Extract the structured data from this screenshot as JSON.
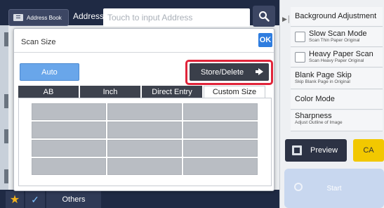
{
  "topbar": {
    "address_book_label": "Address Book",
    "address_label": "Address",
    "address_placeholder": "Touch to input Address"
  },
  "right_panel": {
    "items": [
      {
        "label": "Background Adjustment",
        "sub": ""
      },
      {
        "label": "Slow Scan Mode",
        "sub": "Scan Thin Paper Original"
      },
      {
        "label": "Heavy Paper Scan",
        "sub": "Scan Heavy Paper Original"
      },
      {
        "label": "Blank Page Skip",
        "sub": "Skip Blank Page in Original"
      },
      {
        "label": "Color Mode",
        "sub": ""
      },
      {
        "label": "Sharpness",
        "sub": "Adjust Outline of Image"
      }
    ],
    "preview_label": "Preview",
    "ca_label": "CA",
    "start_label": "Start"
  },
  "bottom": {
    "others_label": "Others"
  },
  "dialog": {
    "title": "Scan Size",
    "ok_label": "OK",
    "auto_label": "Auto",
    "store_delete_label": "Store/Delete",
    "tabs": [
      {
        "label": "AB",
        "active": false
      },
      {
        "label": "Inch",
        "active": false
      },
      {
        "label": "Direct Entry",
        "active": false
      },
      {
        "label": "Custom Size",
        "active": true
      }
    ],
    "size_grid": {
      "rows": 4,
      "cols": 3
    }
  },
  "colors": {
    "accent_blue": "#2f7ddf",
    "highlight_red": "#e0243a",
    "ca_yellow": "#f2c800",
    "dark_navy": "#1f2a44"
  },
  "icons": [
    "address-book-icon",
    "search-icon",
    "collapse-arrow-icon",
    "preview-icon",
    "start-icon",
    "star-icon",
    "check-icon",
    "arrow-right-icon"
  ]
}
